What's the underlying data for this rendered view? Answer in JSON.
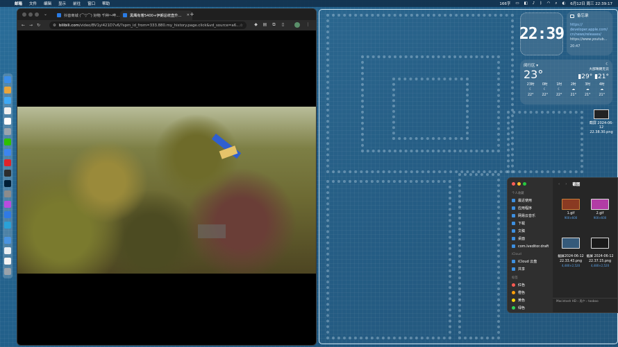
{
  "menubar": {
    "app": "邮箱",
    "items": [
      "文件",
      "编辑",
      "显示",
      "前往",
      "窗口",
      "帮助"
    ],
    "status_text": "166字",
    "datetime": "6月12日 周三 22:39:17"
  },
  "browser": {
    "tabs": [
      {
        "title": "抖音商城 (⌒▽⌒) 好物 千种～哔..."
      },
      {
        "title": "黑鹰有着5400+伊朗总统直升..."
      }
    ],
    "new_tab": "+",
    "url_host": "bilibili.com",
    "url_path": "/video/BV1yi421D7v6/?spm_id_from=333.880.my_history.page.click&vd_source=a6..."
  },
  "widgets": {
    "clock": "22:39",
    "notes": {
      "title": "备忘录",
      "line1": "https://",
      "line2": "developer.apple.com/",
      "line3": "cn/news/releases/",
      "line4": "https://www.youtub...",
      "time": "20:47"
    },
    "weather": {
      "location": "闵行区 ▾",
      "temp": "23°",
      "condition": "大部晴朗无云",
      "hi": "29°",
      "lo": "21°",
      "hours": [
        {
          "label": "23时",
          "temp": "22°"
        },
        {
          "label": "0时",
          "temp": "22°"
        },
        {
          "label": "1时",
          "temp": "22°"
        },
        {
          "label": "2时",
          "temp": "21°"
        },
        {
          "label": "3时",
          "temp": "21°"
        },
        {
          "label": "4时",
          "temp": "21°"
        }
      ]
    }
  },
  "desktop_file": {
    "name1": "截屏 2024-06-12",
    "name2": "22.38.30.png"
  },
  "finder": {
    "title": "截图",
    "sections": {
      "favorites": "个人收藏",
      "icloud": "iCloud",
      "tags": "标签"
    },
    "favorites": [
      "最近使用",
      "应用程序",
      "网易云音乐",
      "下载",
      "文稿",
      "桌面",
      "com.lveditor.draft"
    ],
    "icloud_items": [
      "iCloud 云盘",
      "共享"
    ],
    "tags": [
      {
        "name": "红色",
        "color": "#ff5a52"
      },
      {
        "name": "橙色",
        "color": "#ff9f0a"
      },
      {
        "name": "黄色",
        "color": "#ffd60a"
      },
      {
        "name": "绿色",
        "color": "#30d158"
      }
    ],
    "files": [
      {
        "name": "1.gif",
        "sub": "900×600"
      },
      {
        "name": "2.gif",
        "sub": "900×600"
      },
      {
        "name": "截屏2024-06-12\n22.33.43.png",
        "sub": "4,480×2,520"
      },
      {
        "name": "截屏 2024-06-12\n22.37.15.png",
        "sub": "4,480×2,520"
      }
    ],
    "path": "Macintosh HD › 用户 › tooboo"
  }
}
